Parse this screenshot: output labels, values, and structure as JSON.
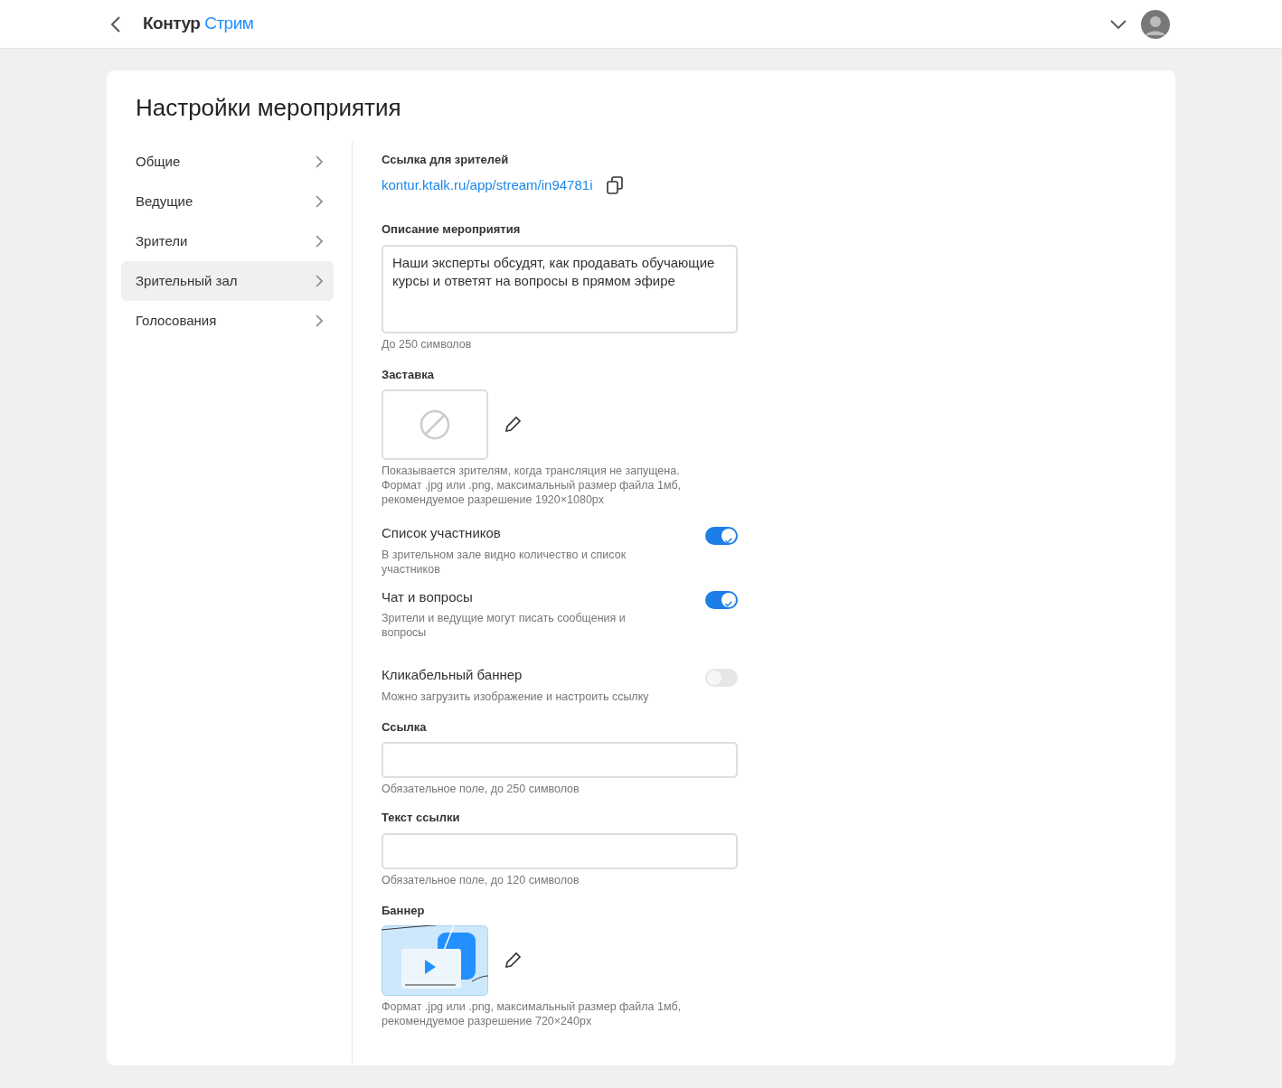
{
  "header": {
    "logo_main": "Контур",
    "logo_accent": "Стрим"
  },
  "title": "Настройки мероприятия",
  "nav": [
    {
      "label": "Общие",
      "selected": false
    },
    {
      "label": "Ведущие",
      "selected": false
    },
    {
      "label": "Зрители",
      "selected": false
    },
    {
      "label": "Зрительный зал",
      "selected": true
    },
    {
      "label": "Голосования",
      "selected": false
    }
  ],
  "viewer_link": {
    "label": "Ссылка для зрителей",
    "url": "kontur.ktalk.ru/app/stream/in94781i"
  },
  "description": {
    "label": "Описание мероприятия",
    "value": "Наши эксперты обсудят, как продавать обучающие курсы и ответят на вопросы в прямом эфире",
    "hint": "До 250 символов"
  },
  "cover": {
    "label": "Заставка",
    "hint_lines": [
      "Показывается зрителям, когда трансляция не запущена.",
      "Формат .jpg или .png, максимальный размер файла 1мб,",
      "рекомендуемое разрешение 1920×1080px"
    ]
  },
  "toggles": [
    {
      "title": "Список участников",
      "description": "В зрительном зале видно количество и список участников",
      "on": true
    },
    {
      "title": "Чат и вопросы",
      "description": "Зрители и ведущие могут писать сообщения и вопросы",
      "on": true
    },
    {
      "title": "Кликабельный баннер",
      "description": "Можно загрузить изображение и настроить ссылку",
      "on": false
    }
  ],
  "fields": [
    {
      "label": "Ссылка",
      "hint": "Обязательное поле, до 250 символов"
    },
    {
      "label": "Текст ссылки",
      "hint": "Обязательное поле, до 120 символов"
    }
  ],
  "banner": {
    "label": "Баннер",
    "hint_lines": [
      "Формат .jpg или .png, максимальный размер файла 1мб,",
      "рекомендуемое разрешение 720×240px"
    ]
  }
}
